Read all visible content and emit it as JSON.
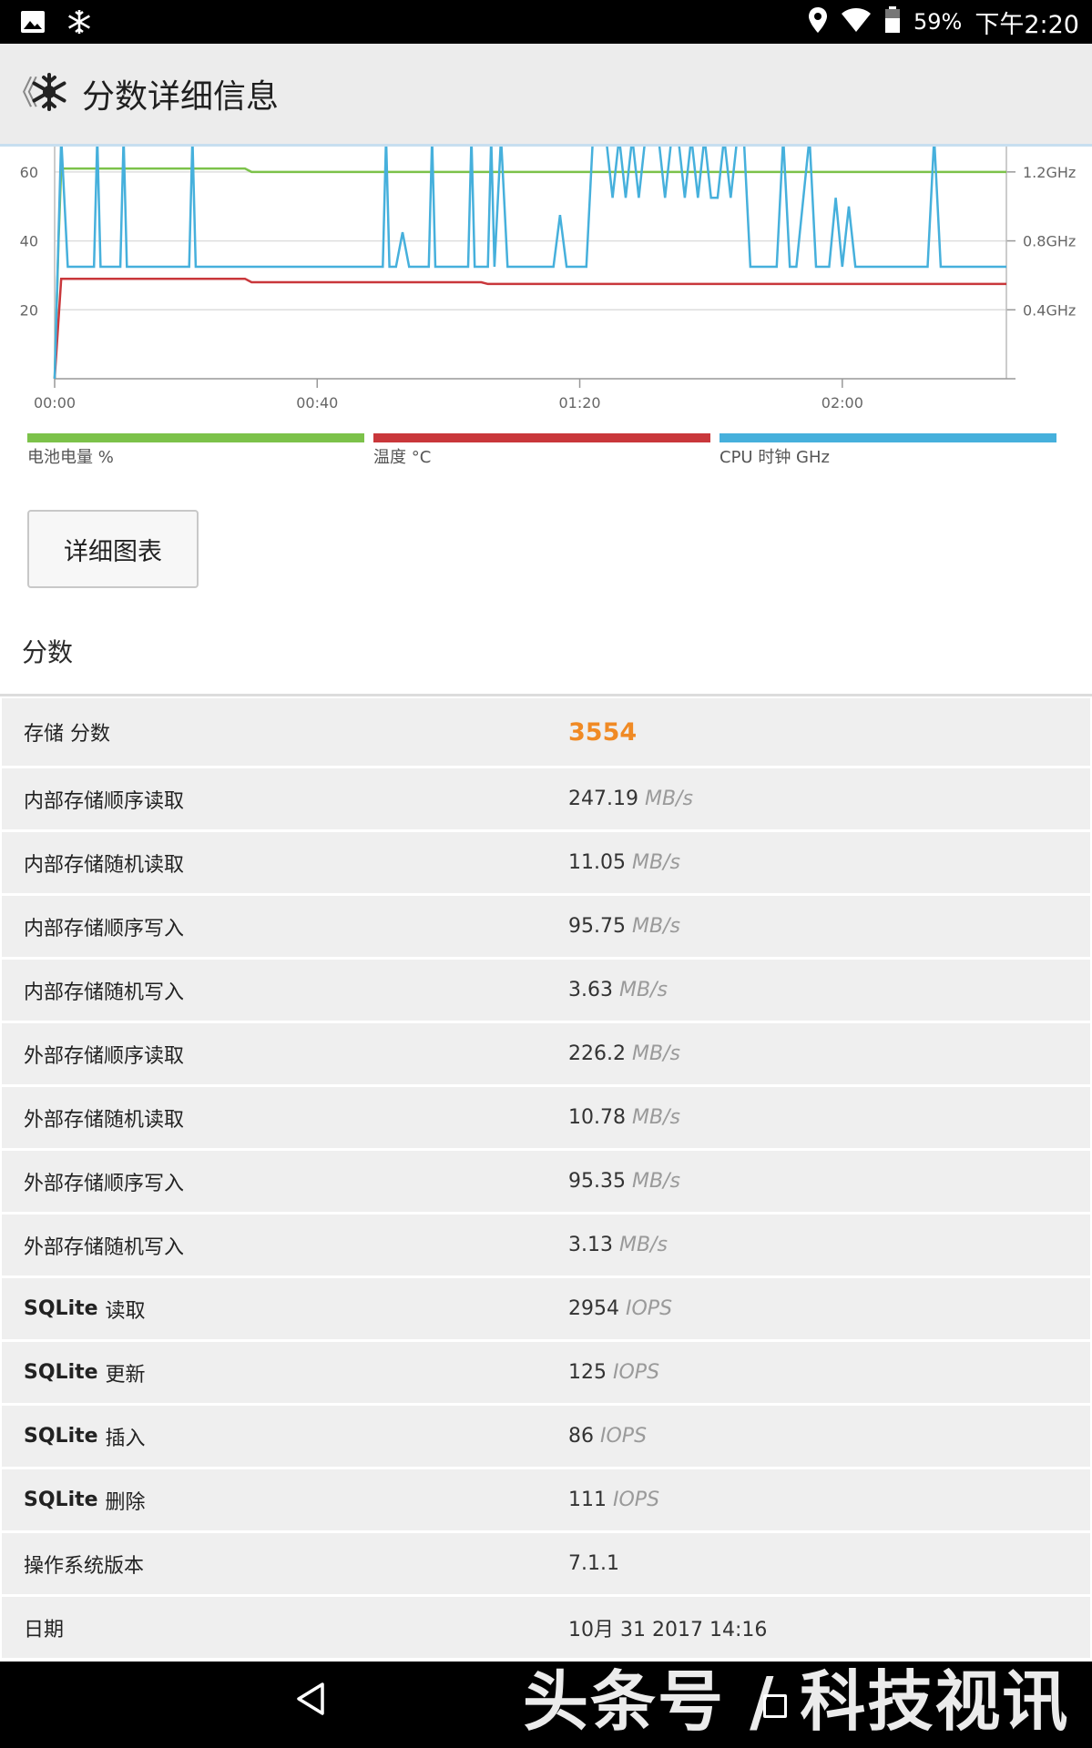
{
  "status_bar": {
    "battery_percent": "59%",
    "time": "下午2:20",
    "icons": [
      "image-icon",
      "snowflake-icon",
      "location-icon",
      "wifi-icon",
      "battery-icon"
    ]
  },
  "header": {
    "back_label": "《",
    "title": "分数详细信息"
  },
  "chart_data": {
    "type": "line",
    "x_ticks": [
      "00:00",
      "00:40",
      "01:20",
      "02:00"
    ],
    "y_left_ticks": [
      "20",
      "40",
      "60"
    ],
    "y_right_ticks": [
      "0.4GHz",
      "0.8GHz",
      "1.2GHz"
    ],
    "x_range_minutes": [
      0,
      145
    ],
    "y_left_range": [
      0,
      70
    ],
    "y_right_range_ghz": [
      0,
      1.4
    ],
    "grid": true,
    "legend_position": "bottom",
    "series": [
      {
        "name": "电池电量 %",
        "color": "#7cc24a",
        "axis": "left",
        "x": [
          0,
          0.6,
          1,
          29,
          30,
          145
        ],
        "y": [
          0,
          40,
          61,
          61,
          60,
          60
        ]
      },
      {
        "name": "温度 °C",
        "color": "#c9373b",
        "axis": "left",
        "x": [
          0,
          1,
          29,
          30,
          65,
          66,
          145
        ],
        "y": [
          0,
          29,
          29,
          28,
          28,
          27.5,
          27.5
        ]
      },
      {
        "name": "CPU 时钟 GHz",
        "color": "#46b0dc",
        "axis": "right",
        "x": [
          0,
          1,
          2,
          6,
          6.5,
          7,
          10,
          10.5,
          11,
          20.5,
          21,
          21.5,
          50,
          50.5,
          51,
          52,
          53,
          54,
          57,
          57.5,
          58,
          63,
          63.5,
          64,
          66,
          66.5,
          67,
          68,
          69,
          69.5,
          70,
          76,
          77,
          78,
          81,
          82,
          84,
          85,
          86,
          87,
          88,
          89,
          90,
          91,
          92,
          93,
          94,
          95,
          96,
          97,
          98,
          99,
          100,
          101,
          102,
          103,
          104,
          105,
          106,
          110,
          111,
          112,
          113,
          115,
          116,
          118,
          119,
          120,
          121,
          122,
          123,
          124,
          125,
          126,
          133,
          134,
          135,
          145
        ],
        "y": [
          0,
          1.4,
          0.65,
          0.65,
          1.4,
          0.65,
          0.65,
          1.4,
          0.65,
          0.65,
          1.4,
          0.65,
          0.65,
          1.4,
          0.65,
          0.65,
          0.85,
          0.65,
          0.65,
          1.4,
          0.65,
          0.65,
          1.4,
          0.65,
          0.65,
          1.4,
          0.65,
          1.4,
          0.65,
          0.65,
          0.65,
          0.65,
          0.95,
          0.65,
          0.65,
          1.4,
          1.4,
          1.05,
          1.4,
          1.05,
          1.4,
          1.05,
          1.4,
          1.4,
          1.4,
          1.05,
          1.4,
          1.4,
          1.05,
          1.4,
          1.05,
          1.4,
          1.05,
          1.05,
          1.4,
          1.05,
          1.4,
          1.4,
          0.65,
          0.65,
          1.4,
          0.65,
          0.65,
          1.4,
          0.65,
          0.65,
          1.05,
          0.65,
          1.0,
          0.65,
          0.65,
          0.65,
          0.65,
          0.65,
          0.65,
          1.4,
          0.65,
          0.65
        ]
      }
    ]
  },
  "legend": [
    {
      "label": "电池电量 %",
      "color": "#7cc24a"
    },
    {
      "label": "温度 °C",
      "color": "#c9373b"
    },
    {
      "label": "CPU 时钟 GHz",
      "color": "#46b0dc"
    }
  ],
  "details_button": "详细图表",
  "section_title": "分数",
  "score": {
    "label": "存储 分数",
    "value": "3554"
  },
  "rows": [
    {
      "label": "内部存储顺序读取",
      "value": "247.19",
      "unit": "MB/s"
    },
    {
      "label": "内部存储随机读取",
      "value": "11.05",
      "unit": "MB/s"
    },
    {
      "label": "内部存储顺序写入",
      "value": "95.75",
      "unit": "MB/s"
    },
    {
      "label": "内部存储随机写入",
      "value": "3.63",
      "unit": "MB/s"
    },
    {
      "label": "外部存储顺序读取",
      "value": "226.2",
      "unit": "MB/s"
    },
    {
      "label": "外部存储随机读取",
      "value": "10.78",
      "unit": "MB/s"
    },
    {
      "label": "外部存储顺序写入",
      "value": "95.35",
      "unit": "MB/s"
    },
    {
      "label": "外部存储随机写入",
      "value": "3.13",
      "unit": "MB/s"
    },
    {
      "label_bold": "SQLite",
      "label": "读取",
      "value": "2954",
      "unit": "IOPS"
    },
    {
      "label_bold": "SQLite",
      "label": "更新",
      "value": "125",
      "unit": "IOPS"
    },
    {
      "label_bold": "SQLite",
      "label": "插入",
      "value": "86",
      "unit": "IOPS"
    },
    {
      "label_bold": "SQLite",
      "label": "删除",
      "value": "111",
      "unit": "IOPS"
    },
    {
      "label": "操作系统版本",
      "value": "7.1.1",
      "unit": ""
    },
    {
      "label": "日期",
      "value": "10月 31 2017 14:16",
      "unit": ""
    }
  ],
  "watermark": "头条号 / 科技视讯"
}
